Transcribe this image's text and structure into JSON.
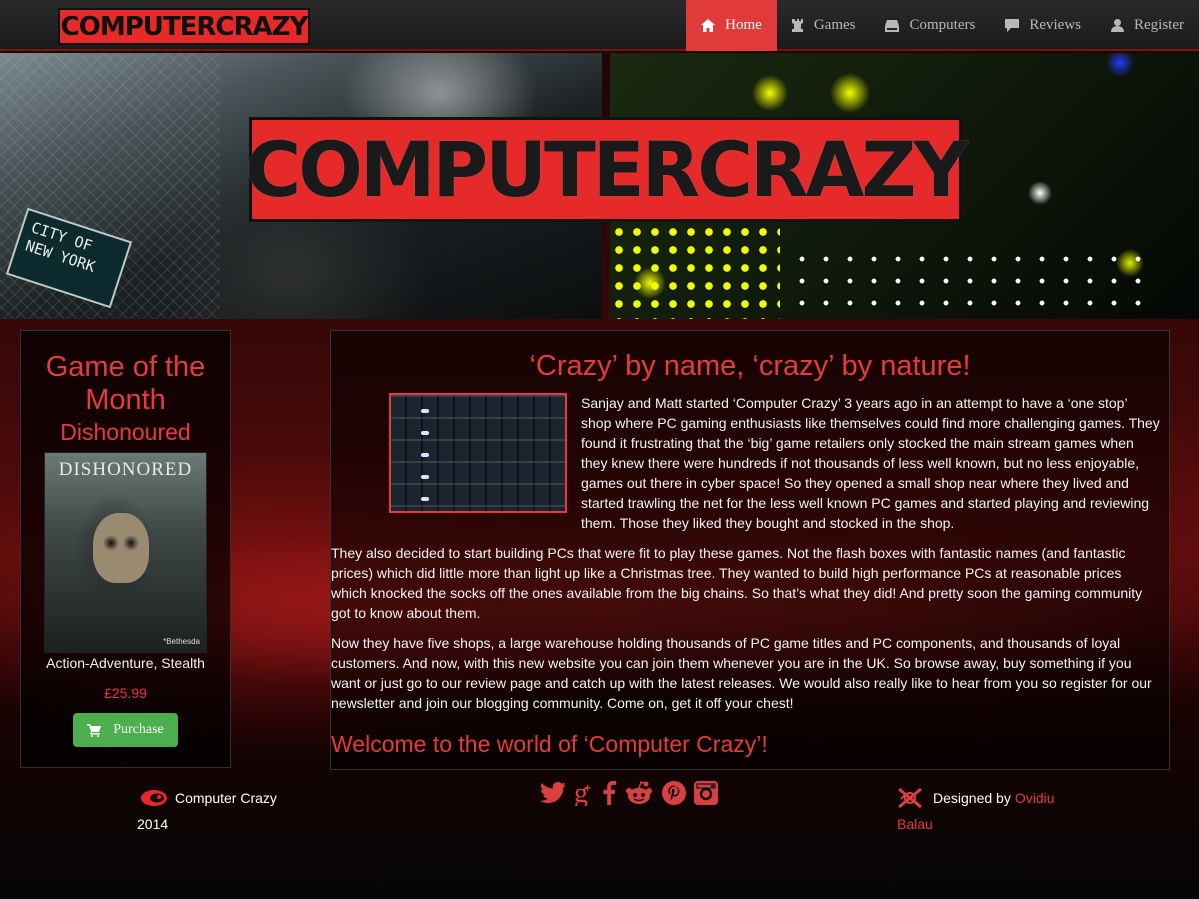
{
  "nav": {
    "brand": "COMPUTERCRAZY",
    "items": [
      {
        "label": "Home",
        "icon": "home-icon",
        "active": true
      },
      {
        "label": "Games",
        "icon": "rook-icon",
        "active": false
      },
      {
        "label": "Computers",
        "icon": "hdd-icon",
        "active": false
      },
      {
        "label": "Reviews",
        "icon": "comment-icon",
        "active": false
      },
      {
        "label": "Register",
        "icon": "user-icon",
        "active": false
      }
    ]
  },
  "hero": {
    "logo": "COMPUTERCRAZY",
    "sign_text": "CITY OF NEW YORK"
  },
  "game_of_month": {
    "heading": "Game of the Month",
    "title": "Dishonoured",
    "cover_title": "DISHONORED",
    "cover_brand": "*Bethesda",
    "genre": "Action-Adventure, Stealth",
    "price": "£25.99",
    "purchase_label": "Purchase"
  },
  "main": {
    "heading": "‘Crazy’ by name, ‘crazy’ by nature!",
    "paragraphs": [
      "Sanjay and Matt started ‘Computer Crazy’ 3 years ago in an attempt to have a ‘one stop’ shop where PC gaming enthusiasts like themselves could find more challenging games. They found it frustrating that the ‘big’ game retailers only stocked the main stream games when they knew there were hundreds if not thousands of less well known, but no less enjoyable, games out there in cyber space! So they opened a small shop near where they lived and started trawling the net for the less well known PC games and started playing and reviewing them. Those they liked they bought and stocked in the shop.",
      "They also decided to start building PCs that were fit to play these games. Not the flash boxes with fantastic names (and fantastic prices) which did little more than light up like a Christmas tree. They wanted to build high performance PCs at reasonable prices which knocked the socks off the ones available from the big chains. So that’s what they did! And pretty soon the gaming community got to know about them.",
      "Now they have five shops, a large warehouse holding thousands of PC game titles and PC components, and thousands of loyal customers. And now, with this new website you can join them whenever you are in the UK. So browse away, buy something if you want or just go to our review page and catch up with the latest releases. We would also really like to hear from you so register for our newsletter and join our blogging community. Come on, get it off your chest!"
    ],
    "welcome": "Welcome to the world of ‘Computer Crazy’!"
  },
  "footer": {
    "company": "Computer Crazy",
    "year": "2014",
    "social": [
      "twitter-icon",
      "google-plus-icon",
      "facebook-icon",
      "reddit-icon",
      "pinterest-icon",
      "instagram-icon"
    ],
    "designed_by": "Designed by",
    "designer_first": "Ovidiu",
    "designer_last": "Balau"
  },
  "colors": {
    "accent": "#e63b3b",
    "purchase": "#4cae4c",
    "nav_bg": "#222222"
  }
}
